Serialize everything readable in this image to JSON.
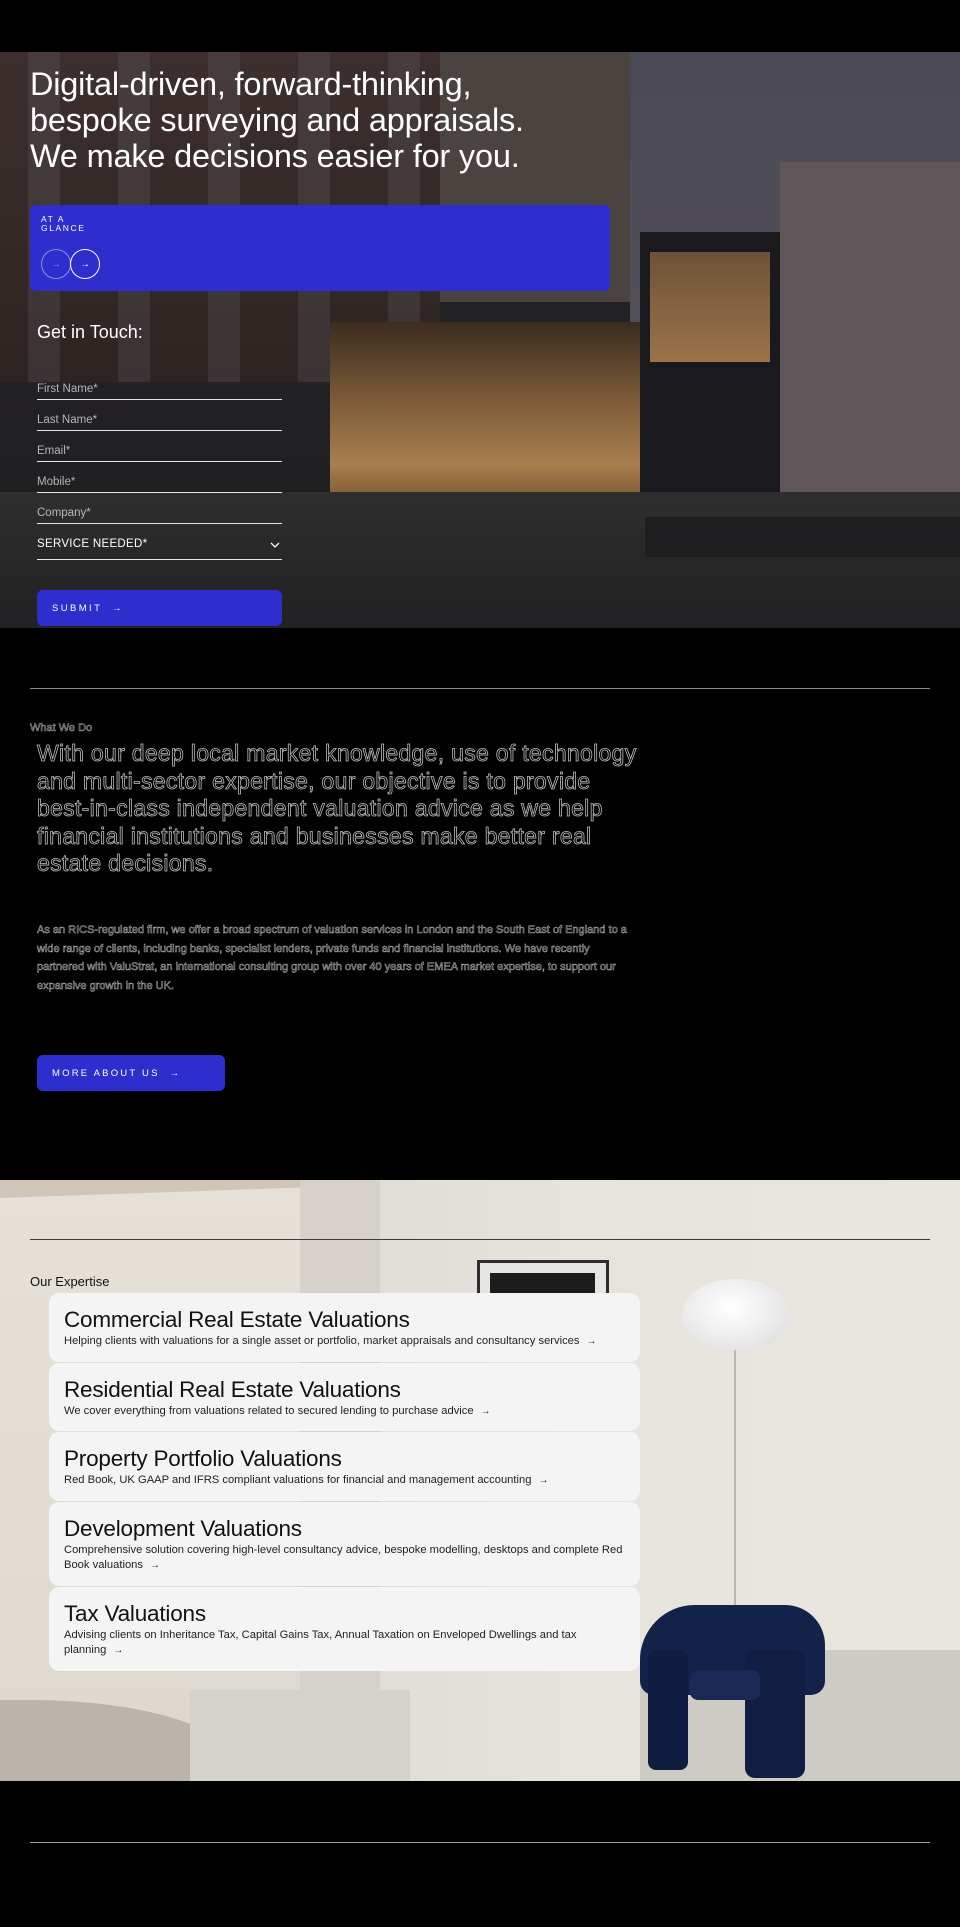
{
  "hero": {
    "headline": "Digital-driven, forward-thinking,\nbespoke surveying and appraisals.\nWe make decisions easier for you.",
    "glance": {
      "label": "AT A\nGLANCE",
      "prev_icon": "arrow-right-icon",
      "next_icon": "arrow-right-icon",
      "prev_glyph": "→",
      "next_glyph": "→"
    },
    "form": {
      "title": "Get in Touch:",
      "fields": [
        {
          "placeholder": "First Name*",
          "value": ""
        },
        {
          "placeholder": "Last Name*",
          "value": ""
        },
        {
          "placeholder": "Email*",
          "value": ""
        },
        {
          "placeholder": "Mobile*",
          "value": ""
        },
        {
          "placeholder": "Company*",
          "value": ""
        }
      ],
      "service_select": {
        "selected": "SERVICE NEEDED*",
        "icon": "chevron-down-icon"
      },
      "submit_label": "SUBMIT",
      "submit_glyph": "→"
    }
  },
  "what_we_do": {
    "label": "What We Do",
    "lead": "With our deep local market knowledge, use of technology and multi-sector expertise, our objective is to provide best-in-class independent valuation advice as we help financial institutions and businesses make better real estate decisions.",
    "paragraph": "As an RICS-regulated firm, we offer a broad spectrum of valuation services in London and the South East of England to a wide range of clients, including banks, specialist lenders, private funds and financial institutions. We have recently partnered with ValuStrat, an international consulting group with over 40 years of EMEA market expertise, to support our expansive growth in the UK.",
    "button_label": "MORE ABOUT US",
    "button_glyph": "→"
  },
  "expertise": {
    "label": "Our Expertise",
    "arrow_glyph": "→",
    "cards": [
      {
        "title": "Commercial Real Estate Valuations",
        "description": "Helping clients with valuations for a single asset or portfolio, market appraisals and consultancy services"
      },
      {
        "title": "Residential Real Estate Valuations",
        "description": "We cover everything from valuations related to secured lending to purchase advice"
      },
      {
        "title": "Property Portfolio Valuations",
        "description": "Red Book, UK GAAP and IFRS compliant valuations for financial and management accounting"
      },
      {
        "title": "Development Valuations",
        "description": "Comprehensive solution covering high-level consultancy advice, bespoke modelling, desktops and complete Red Book valuations"
      },
      {
        "title": "Tax Valuations",
        "description": "Advising clients on Inheritance Tax, Capital Gains Tax, Annual Taxation on Enveloped Dwellings and tax planning"
      }
    ]
  },
  "colors": {
    "accent": "#2e2ecf",
    "background": "#000000",
    "card": "#f4f4f4"
  }
}
